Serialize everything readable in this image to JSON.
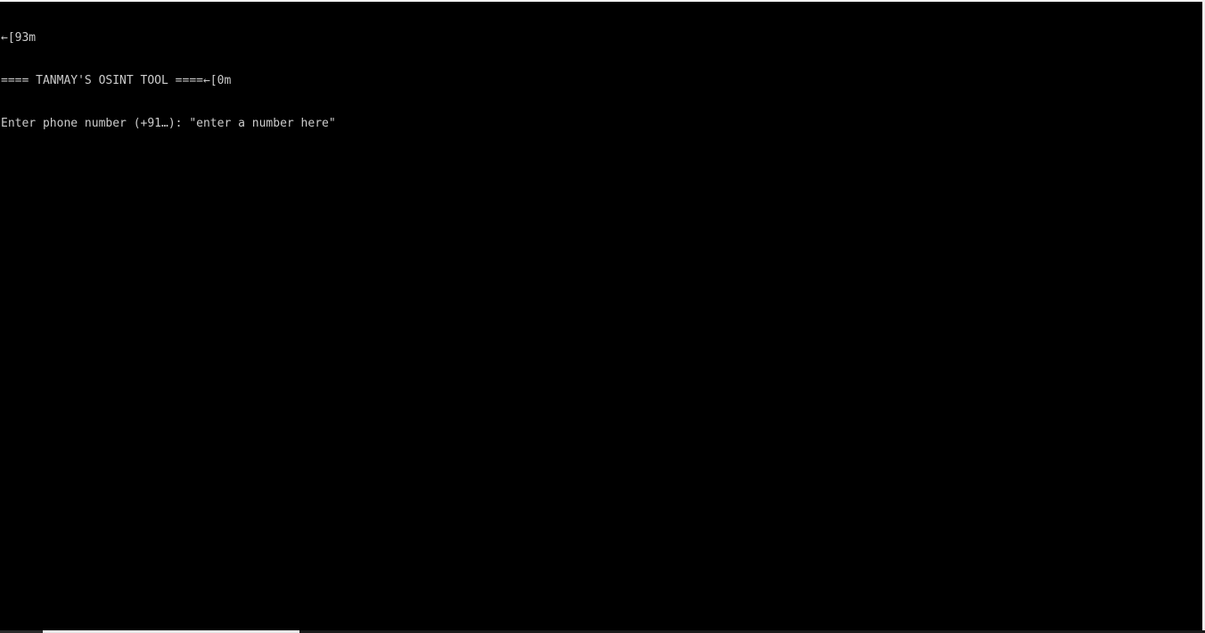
{
  "console": {
    "lines": [
      "←[93m",
      "==== TANMAY'S OSINT TOOL ====←[0m",
      "Enter phone number (+91…): \"enter a number here\""
    ]
  },
  "colors": {
    "background": "#000000",
    "text": "#cccccc"
  }
}
